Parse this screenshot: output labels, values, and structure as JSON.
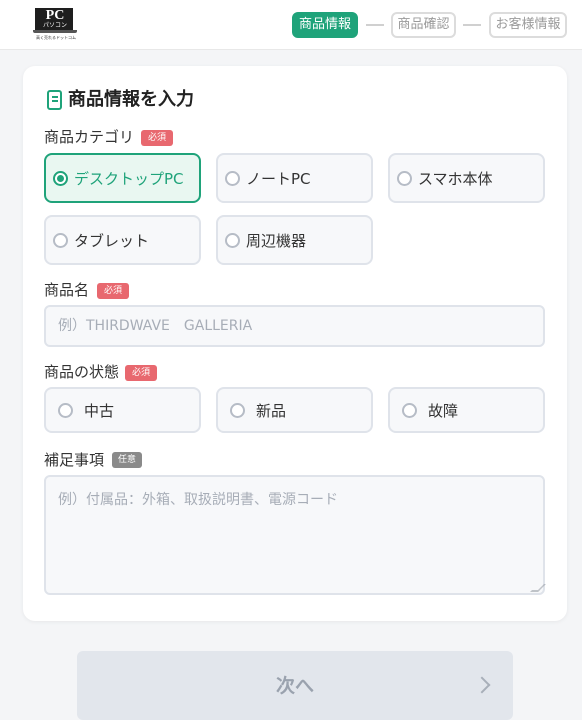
{
  "header": {
    "logo": {
      "main": "PC",
      "kana": "パソコン",
      "tagline": "高く売れるドットコム"
    },
    "steps": [
      {
        "label": "商品情報",
        "active": true
      },
      {
        "label": "商品確認",
        "active": false
      },
      {
        "label": "お客様情報",
        "active": false
      }
    ]
  },
  "form": {
    "title": "商品情報を入力",
    "title_icon": "document-icon",
    "category": {
      "label": "商品カテゴリ",
      "badge": "必須",
      "options": [
        {
          "label": "デスクトップPC",
          "selected": true
        },
        {
          "label": "ノートPC",
          "selected": false
        },
        {
          "label": "スマホ本体",
          "selected": false
        },
        {
          "label": "タブレット",
          "selected": false
        },
        {
          "label": "周辺機器",
          "selected": false
        }
      ]
    },
    "product_name": {
      "label": "商品名",
      "badge": "必須",
      "placeholder": "例）THIRDWAVE　GALLERIA",
      "value": ""
    },
    "condition": {
      "label": "商品の状態",
      "badge": "必須",
      "options": [
        {
          "label": "中古",
          "selected": false
        },
        {
          "label": "新品",
          "selected": false
        },
        {
          "label": "故障",
          "selected": false
        }
      ]
    },
    "notes": {
      "label": "補足事項",
      "badge": "任意",
      "placeholder": "例）付属品：外箱、取扱説明書、電源コード",
      "value": ""
    }
  },
  "next_button": {
    "label": "次へ",
    "icon": "chevron-right-icon"
  },
  "colors": {
    "accent": "#1fa37a",
    "required_badge": "#e8686f",
    "optional_badge": "#8a8a8a"
  }
}
